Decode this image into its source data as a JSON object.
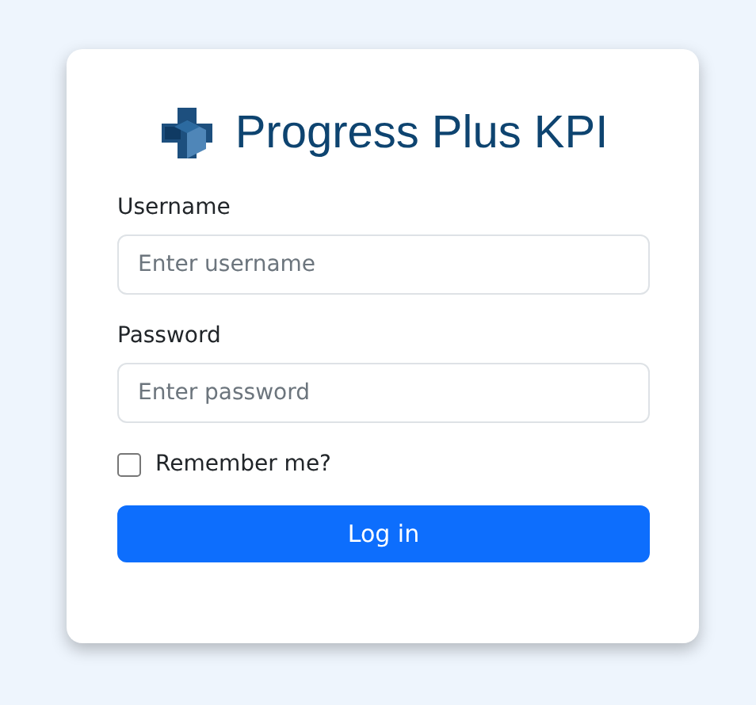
{
  "title": "Progress Plus KPI",
  "fields": [
    {
      "label": "Username",
      "placeholder": "Enter username"
    },
    {
      "label": "Password",
      "placeholder": "Enter password"
    }
  ],
  "remember": {
    "label": "Remember me?",
    "checked": false
  },
  "button": "Log in"
}
